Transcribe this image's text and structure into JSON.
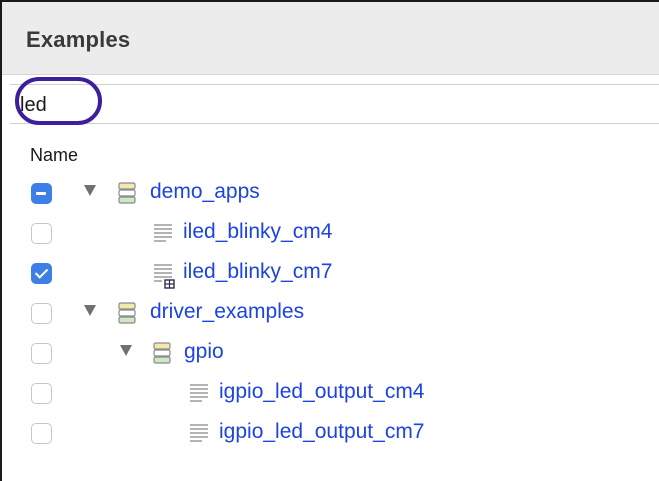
{
  "panel": {
    "title": "Examples"
  },
  "search": {
    "value": "led"
  },
  "tree": {
    "column_header": "Name",
    "items": [
      {
        "label": "demo_apps",
        "type": "folder",
        "checkbox": "mixed",
        "expanded": true
      },
      {
        "label": "iled_blinky_cm4",
        "type": "file",
        "checkbox": "unchecked"
      },
      {
        "label": "iled_blinky_cm7",
        "type": "file-linked",
        "checkbox": "checked"
      },
      {
        "label": "driver_examples",
        "type": "folder",
        "checkbox": "unchecked",
        "expanded": true
      },
      {
        "label": "gpio",
        "type": "folder",
        "checkbox": "unchecked",
        "expanded": true
      },
      {
        "label": "igpio_led_output_cm4",
        "type": "file",
        "checkbox": "unchecked"
      },
      {
        "label": "igpio_led_output_cm7",
        "type": "file",
        "checkbox": "unchecked"
      }
    ]
  },
  "icons": {
    "folder": "stacked-folder-icon",
    "file": "text-document-icon",
    "file-linked": "text-document-linked-icon",
    "toggle": "disclosure-triangle-down-icon"
  },
  "colors": {
    "link_text": "#1d43e0",
    "checkbox_accent": "#3d7fe6",
    "highlight": "#3d1e9c",
    "header_bg": "#ececec"
  }
}
